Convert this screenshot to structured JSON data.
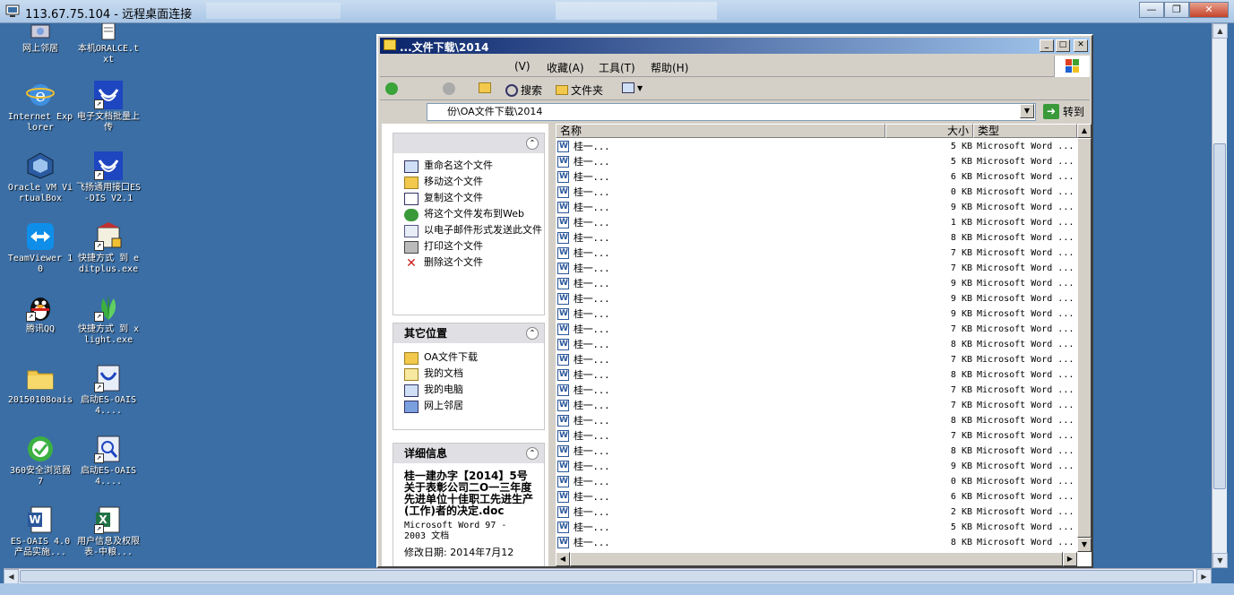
{
  "rdp": {
    "title": "113.67.75.104 - 远程桌面连接"
  },
  "desktop": {
    "icons": [
      {
        "label": "网上邻居"
      },
      {
        "label": "本机ORALCE.txt"
      },
      {
        "label": "Internet Explorer"
      },
      {
        "label": "电子文档批量上传"
      },
      {
        "label": "Oracle VM VirtualBox"
      },
      {
        "label": "飞扬通用接口ES-DIS V2.1"
      },
      {
        "label": "TeamViewer 10"
      },
      {
        "label": "快捷方式 到 editplus.exe"
      },
      {
        "label": "腾讯QQ"
      },
      {
        "label": "快捷方式 到 xlight.exe"
      },
      {
        "label": "20150108oais"
      },
      {
        "label": "启动ES-OAIS4...."
      },
      {
        "label": "360安全浏览器7"
      },
      {
        "label": "启动ES-OAIS4...."
      },
      {
        "label": "ES-OAIS 4.0产品实施..."
      },
      {
        "label": "用户信息及权限表-中粮..."
      }
    ]
  },
  "explorer": {
    "title": "...文件下载\\2014",
    "menus": [
      "(V)",
      "收藏(A)",
      "工具(T)",
      "帮助(H)"
    ],
    "toolbar": {
      "search": "搜索",
      "folders": "文件夹"
    },
    "address": {
      "value": "份\\OA文件下载\\2014",
      "go": "转到"
    },
    "file_tasks": {
      "items": [
        "重命名这个文件",
        "移动这个文件",
        "复制这个文件",
        "将这个文件发布到Web",
        "以电子邮件形式发送此文件",
        "打印这个文件",
        "删除这个文件"
      ]
    },
    "other_places": {
      "title": "其它位置",
      "items": [
        "OA文件下载",
        "我的文档",
        "我的电脑",
        "网上邻居"
      ]
    },
    "details": {
      "title": "详细信息",
      "filename": "桂一建办字【2014】5号关于表彰公司二O一三年度先进单位十佳职工先进生产(工作)者的决定.doc",
      "type": "Microsoft Word 97 - 2003 文档",
      "modified": "修改日期: 2014年7月12"
    },
    "list": {
      "columns": [
        "名称",
        "大小",
        "类型"
      ],
      "rows": [
        {
          "name": "桂一...",
          "size": "5 KB",
          "type": "Microsoft Word ..."
        },
        {
          "name": "桂一...",
          "size": "5 KB",
          "type": "Microsoft Word ..."
        },
        {
          "name": "桂一...",
          "size": "6 KB",
          "type": "Microsoft Word ..."
        },
        {
          "name": "桂一...",
          "size": "0 KB",
          "type": "Microsoft Word ..."
        },
        {
          "name": "桂一...",
          "size": "9 KB",
          "type": "Microsoft Word ..."
        },
        {
          "name": "桂一...",
          "size": "1 KB",
          "type": "Microsoft Word ..."
        },
        {
          "name": "桂一...",
          "size": "8 KB",
          "type": "Microsoft Word ..."
        },
        {
          "name": "桂一...",
          "size": "7 KB",
          "type": "Microsoft Word ..."
        },
        {
          "name": "桂一...",
          "size": "7 KB",
          "type": "Microsoft Word ..."
        },
        {
          "name": "桂一...",
          "size": "9 KB",
          "type": "Microsoft Word ..."
        },
        {
          "name": "桂一...",
          "size": "9 KB",
          "type": "Microsoft Word ..."
        },
        {
          "name": "桂一...",
          "size": "9 KB",
          "type": "Microsoft Word ..."
        },
        {
          "name": "桂一...",
          "size": "7 KB",
          "type": "Microsoft Word ..."
        },
        {
          "name": "桂一...",
          "size": "8 KB",
          "type": "Microsoft Word ..."
        },
        {
          "name": "桂一...",
          "size": "7 KB",
          "type": "Microsoft Word ..."
        },
        {
          "name": "桂一...",
          "size": "8 KB",
          "type": "Microsoft Word ..."
        },
        {
          "name": "桂一...",
          "size": "7 KB",
          "type": "Microsoft Word ..."
        },
        {
          "name": "桂一...",
          "size": "7 KB",
          "type": "Microsoft Word ..."
        },
        {
          "name": "桂一...",
          "size": "8 KB",
          "type": "Microsoft Word ..."
        },
        {
          "name": "桂一...",
          "size": "7 KB",
          "type": "Microsoft Word ..."
        },
        {
          "name": "桂一...",
          "size": "8 KB",
          "type": "Microsoft Word ..."
        },
        {
          "name": "桂一...",
          "size": "9 KB",
          "type": "Microsoft Word ..."
        },
        {
          "name": "桂一...",
          "size": "0 KB",
          "type": "Microsoft Word ..."
        },
        {
          "name": "桂一...",
          "size": "6 KB",
          "type": "Microsoft Word ..."
        },
        {
          "name": "桂一...",
          "size": "2 KB",
          "type": "Microsoft Word ..."
        },
        {
          "name": "桂一...",
          "size": "5 KB",
          "type": "Microsoft Word ..."
        },
        {
          "name": "桂一...",
          "size": "8 KB",
          "type": "Microsoft Word ..."
        }
      ]
    }
  },
  "colors": {
    "desktop": "#3a6ea5",
    "titlebar_start": "#0a246a",
    "titlebar_end": "#a6caf0",
    "window": "#d4d0c8"
  }
}
